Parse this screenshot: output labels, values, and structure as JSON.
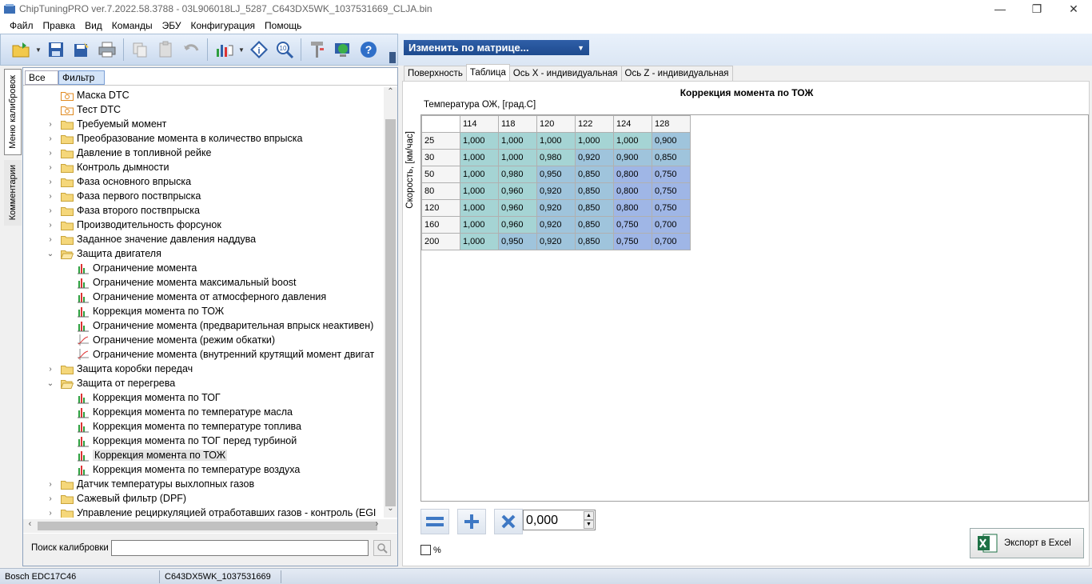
{
  "window": {
    "title": "ChipTuningPRO ver.7.2022.58.3788 - 03L906018LJ_5287_C643DX5WK_1037531669_CLJA.bin",
    "controls": [
      "minimize-icon",
      "restore-icon",
      "close-icon"
    ]
  },
  "menu": [
    "Файл",
    "Правка",
    "Вид",
    "Команды",
    "ЭБУ",
    "Конфигурация",
    "Помощь"
  ],
  "toolbar": {
    "icons": [
      "open-folder-icon",
      "save-icon",
      "save-as-icon",
      "print-icon",
      "copy-icon",
      "paste-icon",
      "undo-icon",
      "chart-icon",
      "info-icon",
      "search-calibration-icon",
      "tools-icon",
      "web-icon",
      "help-icon"
    ],
    "matrix_dropdown": "Изменить по матрице..."
  },
  "side_tabs": [
    "Меню калибровок",
    "Комментарии"
  ],
  "filter_tabs": {
    "all": "Все",
    "filter": "Фильтр"
  },
  "tree": [
    {
      "label": "Маска DTC",
      "level": 0,
      "icon": "dtc-folder-icon",
      "expander": ""
    },
    {
      "label": "Тест DTC",
      "level": 0,
      "icon": "dtc-folder-icon",
      "expander": ""
    },
    {
      "label": "Требуемый момент",
      "level": 0,
      "icon": "folder-icon",
      "expander": ">"
    },
    {
      "label": "Преобразование момента в количество впрыска",
      "level": 0,
      "icon": "folder-icon",
      "expander": ">"
    },
    {
      "label": "Давление в топливной рейке",
      "level": 0,
      "icon": "folder-icon",
      "expander": ">"
    },
    {
      "label": "Контроль дымности",
      "level": 0,
      "icon": "folder-icon",
      "expander": ">"
    },
    {
      "label": "Фаза основного впрыска",
      "level": 0,
      "icon": "folder-icon",
      "expander": ">"
    },
    {
      "label": "Фаза первого поствпрыска",
      "level": 0,
      "icon": "folder-icon",
      "expander": ">"
    },
    {
      "label": "Фаза второго поствпрыска",
      "level": 0,
      "icon": "folder-icon",
      "expander": ">"
    },
    {
      "label": "Производительность форсунок",
      "level": 0,
      "icon": "folder-icon",
      "expander": ">"
    },
    {
      "label": "Заданное значение давления наддува",
      "level": 0,
      "icon": "folder-icon",
      "expander": ">"
    },
    {
      "label": "Защита двигателя",
      "level": 0,
      "icon": "folder-open-icon",
      "expander": "v"
    },
    {
      "label": "Ограничение момента",
      "level": 1,
      "icon": "map-chart-icon"
    },
    {
      "label": "Ограничение момента максимальный boost",
      "level": 1,
      "icon": "map-chart-icon"
    },
    {
      "label": "Ограничение момента от атмосферного давления",
      "level": 1,
      "icon": "map-chart-icon"
    },
    {
      "label": "Коррекция момента по ТОЖ",
      "level": 1,
      "icon": "map-chart-icon"
    },
    {
      "label": "Ограничение момента (предварительная впрыск неактивен)",
      "level": 1,
      "icon": "map-chart-icon"
    },
    {
      "label": "Ограничение момента (режим обкатки)",
      "level": 1,
      "icon": "curve-chart-icon"
    },
    {
      "label": "Ограничение момента (внутренний крутящий момент двигат",
      "level": 1,
      "icon": "curve-chart-icon"
    },
    {
      "label": "Защита коробки передач",
      "level": 0,
      "icon": "folder-icon",
      "expander": ">"
    },
    {
      "label": "Защита от перегрева",
      "level": 0,
      "icon": "folder-open-icon",
      "expander": "v"
    },
    {
      "label": "Коррекция момента по ТОГ",
      "level": 1,
      "icon": "map-chart-icon"
    },
    {
      "label": "Коррекция момента по температуре масла",
      "level": 1,
      "icon": "map-chart-icon"
    },
    {
      "label": "Коррекция момента по температуре топлива",
      "level": 1,
      "icon": "map-chart-icon"
    },
    {
      "label": "Коррекция момента по ТОГ перед турбиной",
      "level": 1,
      "icon": "map-chart-icon"
    },
    {
      "label": "Коррекция момента по ТОЖ",
      "level": 1,
      "icon": "map-chart-icon",
      "selected": true
    },
    {
      "label": "Коррекция момента по температуре воздуха",
      "level": 1,
      "icon": "map-chart-icon"
    },
    {
      "label": "Датчик температуры выхлопных газов",
      "level": 0,
      "icon": "folder-icon",
      "expander": ">"
    },
    {
      "label": "Сажевый фильтр (DPF)",
      "level": 0,
      "icon": "folder-icon",
      "expander": ">"
    },
    {
      "label": "Управление рециркуляцией отработавших газов - контроль (EGI",
      "level": 0,
      "icon": "folder-icon",
      "expander": ">"
    }
  ],
  "search": {
    "label": "Поиск калибровки",
    "value": "",
    "button_icon": "search-icon"
  },
  "tabs": [
    "Поверхность",
    "Таблица",
    "Ось X - индивидуальная",
    "Ось Z - индивидуальная"
  ],
  "active_tab": "Таблица",
  "map": {
    "title": "Коррекция момента по ТОЖ",
    "x_label": "Температура ОЖ, [град.С]",
    "y_label": "Скорость, [км/час]",
    "x_axis": [
      "114",
      "118",
      "120",
      "122",
      "124",
      "128"
    ],
    "y_axis": [
      "25",
      "30",
      "50",
      "80",
      "120",
      "160",
      "200"
    ],
    "values": [
      [
        "1,000",
        "1,000",
        "1,000",
        "1,000",
        "1,000",
        "0,900"
      ],
      [
        "1,000",
        "1,000",
        "0,980",
        "0,920",
        "0,900",
        "0,850"
      ],
      [
        "1,000",
        "0,980",
        "0,950",
        "0,850",
        "0,800",
        "0,750"
      ],
      [
        "1,000",
        "0,960",
        "0,920",
        "0,850",
        "0,800",
        "0,750"
      ],
      [
        "1,000",
        "0,960",
        "0,920",
        "0,850",
        "0,800",
        "0,750"
      ],
      [
        "1,000",
        "0,960",
        "0,920",
        "0,850",
        "0,750",
        "0,700"
      ],
      [
        "1,000",
        "0,950",
        "0,920",
        "0,850",
        "0,750",
        "0,700"
      ]
    ],
    "colors": {
      "high": "#a5d4d4",
      "mid": "#9fc4dc",
      "low": "#9fb6e6"
    }
  },
  "controls": {
    "buttons": [
      "equals-icon",
      "plus-icon",
      "cross-icon"
    ],
    "step_value": "0,000",
    "percent_label": "%",
    "export_label": "Экспорт в Excel"
  },
  "status": [
    "Bosch EDC17C46",
    "C643DX5WK_1037531669",
    ""
  ]
}
